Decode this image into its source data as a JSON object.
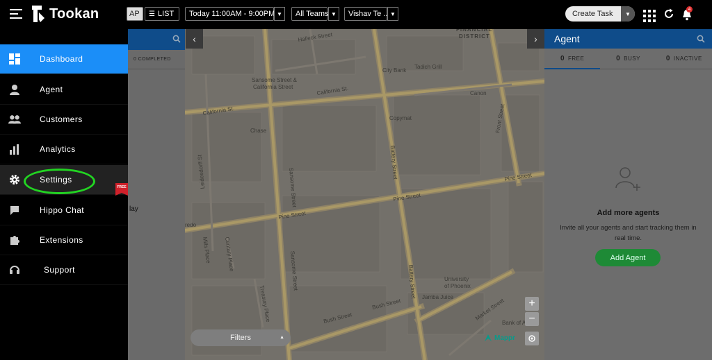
{
  "app": {
    "name": "Tookan"
  },
  "toolbar": {
    "map_label": "AP",
    "list_label": "LIST",
    "date_range": "Today 11:00AM - 9:00PM",
    "teams": "All Teams",
    "user": "Vishav Te ..",
    "create_task": "Create Task",
    "notification_count": "4"
  },
  "sidebar": {
    "items": [
      {
        "label": "Dashboard",
        "icon": "dashboard-icon"
      },
      {
        "label": "Agent",
        "icon": "agent-icon"
      },
      {
        "label": "Customers",
        "icon": "customers-icon"
      },
      {
        "label": "Analytics",
        "icon": "analytics-icon"
      },
      {
        "label": "Settings",
        "icon": "gear-icon"
      },
      {
        "label": "Hippo Chat",
        "icon": "chat-icon"
      },
      {
        "label": "Extensions",
        "icon": "puzzle-icon"
      },
      {
        "label": "Support",
        "icon": "headset-icon"
      }
    ],
    "free_badge": "FREE"
  },
  "tasks": {
    "completed_label": "0 COMPLETED",
    "fragment": "lay"
  },
  "map": {
    "district": "FINANCIAL\nDISTRICT",
    "streets": [
      "Halleck Street",
      "California St.",
      "California St.",
      "Sansome Street",
      "Pine Street",
      "Pine Street",
      "Pine Street",
      "Battery Street",
      "Battery Street",
      "Front Street",
      "Bush Street",
      "Bush Street",
      "Market Street",
      "Leidesdorff St",
      "Mills Place",
      "Century Place",
      "Treasury Place",
      "Sansome Street",
      "Battery Street"
    ],
    "places": [
      "City Bank",
      "Tadich Grill",
      "Canon",
      "Sansome Street & California Street",
      "Chase",
      "Copymat",
      "University of Phoenix",
      "Jamba Juice",
      "Bank of A",
      "redo"
    ],
    "filters_label": "Filters",
    "brand": "Mappr",
    "zoom_in": "+",
    "zoom_out": "−",
    "prev": "‹",
    "next": "›"
  },
  "agents": {
    "title": "Agent",
    "tabs": [
      {
        "count": "0",
        "label": "FREE"
      },
      {
        "count": "0",
        "label": "BUSY"
      },
      {
        "count": "0",
        "label": "INACTIVE"
      }
    ],
    "empty_title": "Add more agents",
    "empty_text": "Invite all your agents and start tracking them in real time.",
    "add_button": "Add Agent"
  },
  "colors": {
    "accent": "#1b8ef8",
    "highlight": "#22d422",
    "add_button": "#1e8a36",
    "badge": "#d0202a"
  }
}
